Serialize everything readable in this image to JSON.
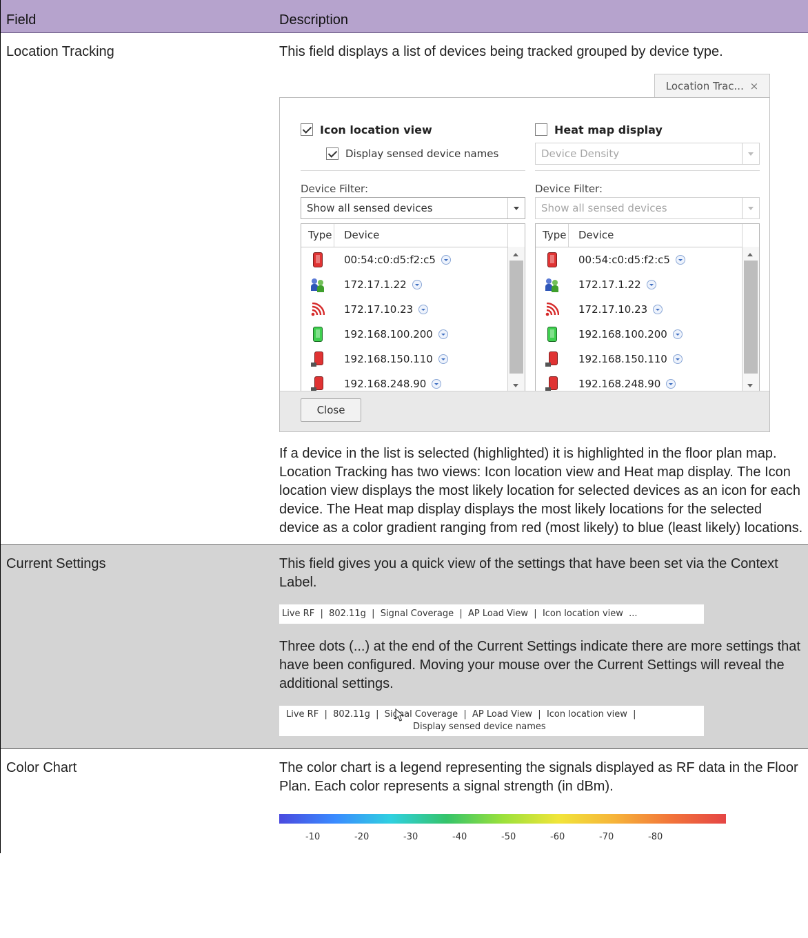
{
  "table": {
    "header": {
      "field": "Field",
      "description": "Description"
    },
    "location_tracking": {
      "field": "Location Tracking",
      "intro": "This field displays a list of devices being tracked grouped by device type.",
      "dialog": {
        "tab_title": "Location Trac...",
        "tab_close": "×",
        "icon_location_view": "Icon location view",
        "display_sensed_names": "Display sensed device names",
        "heat_map_display": "Heat map display",
        "heat_map_select": "Device Density",
        "left_filter_label": "Device Filter:",
        "left_filter_value": "Show all sensed devices",
        "right_filter_label": "Device Filter:",
        "right_filter_value": "Show all sensed devices",
        "col_type": "Type",
        "col_device": "Device",
        "devices": [
          {
            "icon": "red-phone-icon",
            "name": "00:54:c0:d5:f2:c5"
          },
          {
            "icon": "users-icon",
            "name": "172.17.1.22"
          },
          {
            "icon": "wifi-signal-icon",
            "name": "172.17.10.23"
          },
          {
            "icon": "green-phone-icon",
            "name": "192.168.100.200"
          },
          {
            "icon": "wireless-client-icon",
            "name": "192.168.150.110"
          },
          {
            "icon": "wireless-client-icon",
            "name": "192.168.248.90"
          }
        ],
        "close_label": "Close"
      },
      "para1": "If a device in the list is selected (highlighted) it is highlighted in the floor plan map.",
      "para2": "Location Tracking has two views: Icon location view and Heat map display. The Icon location view displays the most likely location for selected devices as an icon for each device. The Heat map display displays the most likely locations for the selected device as a color gradient ranging from red (most likely) to blue (least likely) locations."
    },
    "current_settings": {
      "field": "Current Settings",
      "intro": "This field gives you a quick view of the settings that have been set via the Context Label.",
      "strip1": "Live RF  |  802.11g  |  Signal Coverage  |  AP Load View  |  Icon location view  ...",
      "para": "Three dots (...) at the end of the Current Settings indicate there are more settings that have been configured. Moving your mouse over the Current Settings will reveal the additional settings.",
      "strip2_line1": "Live RF  |  802.11g  |  Signal Coverage  |  AP Load View  |  Icon location view  |",
      "strip2_line2": "Display sensed device names"
    },
    "color_chart": {
      "field": "Color Chart",
      "intro": "The color chart is a legend representing the signals displayed as RF data in the Floor Plan. Each color represents a signal strength (in dBm).",
      "ticks": [
        "-10",
        "-20",
        "-30",
        "-40",
        "-50",
        "-60",
        "-70",
        "-80"
      ]
    }
  }
}
